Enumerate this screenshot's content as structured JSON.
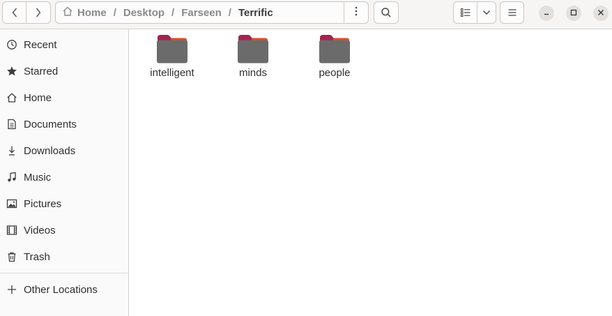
{
  "colors": {
    "folder_body": "#6b6b6b",
    "folder_tab": "#a4244f",
    "folder_accent": "#e95420"
  },
  "header": {
    "back_icon": "chevron-left-icon",
    "forward_icon": "chevron-right-icon",
    "breadcrumbs": [
      {
        "label": "Home",
        "icon": "home-icon"
      },
      {
        "label": "Desktop"
      },
      {
        "label": "Farseen"
      },
      {
        "label": "Terrific",
        "current": true
      }
    ],
    "separator": "/",
    "path_menu_icon": "vertical-dots-icon",
    "search_icon": "search-icon",
    "view_icon": "list-view-icon",
    "view_dropdown_icon": "chevron-down-icon",
    "menu_icon": "hamburger-menu-icon",
    "window_controls": [
      "minimize-icon",
      "maximize-icon",
      "close-icon"
    ]
  },
  "sidebar": {
    "items": [
      {
        "label": "Recent",
        "icon": "clock-icon"
      },
      {
        "label": "Starred",
        "icon": "star-icon"
      },
      {
        "label": "Home",
        "icon": "home-icon"
      },
      {
        "label": "Documents",
        "icon": "document-icon"
      },
      {
        "label": "Downloads",
        "icon": "download-icon"
      },
      {
        "label": "Music",
        "icon": "music-note-icon"
      },
      {
        "label": "Pictures",
        "icon": "picture-icon"
      },
      {
        "label": "Videos",
        "icon": "film-icon"
      },
      {
        "label": "Trash",
        "icon": "trash-icon"
      }
    ],
    "other_locations": {
      "label": "Other Locations",
      "icon": "plus-icon"
    }
  },
  "content": {
    "items": [
      {
        "name": "intelligent",
        "type": "folder"
      },
      {
        "name": "minds",
        "type": "folder"
      },
      {
        "name": "people",
        "type": "folder"
      }
    ]
  }
}
